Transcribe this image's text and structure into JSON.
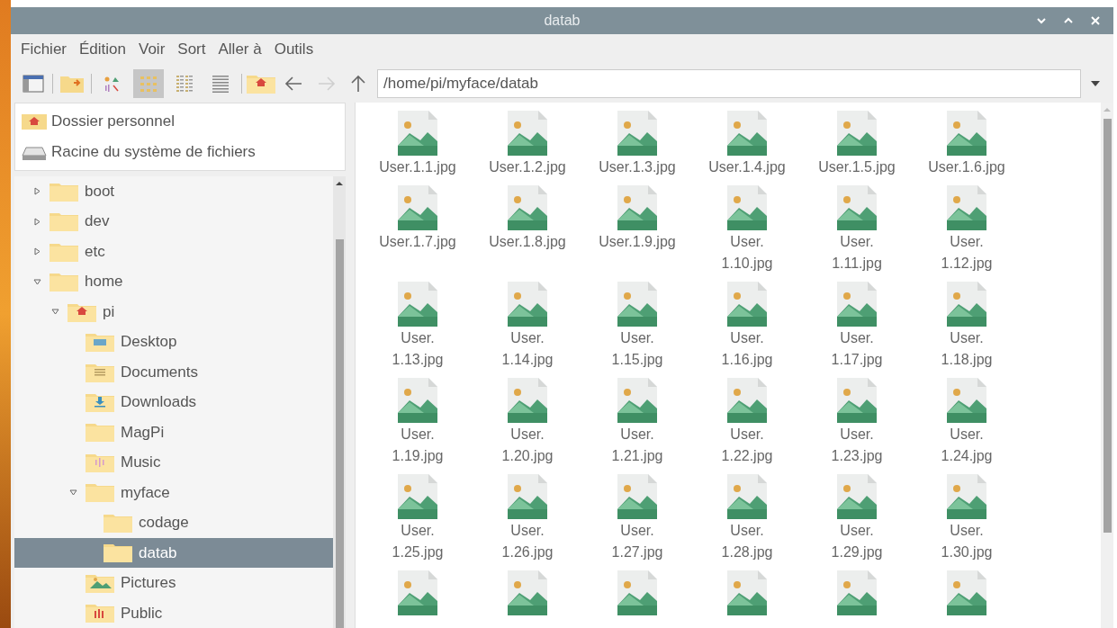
{
  "window": {
    "title": "datab",
    "controls": [
      {
        "kind": "minimize"
      },
      {
        "kind": "maximize"
      },
      {
        "kind": "close"
      }
    ]
  },
  "menu": [
    "Fichier",
    "Édition",
    "Voir",
    "Sort",
    "Aller à",
    "Outils"
  ],
  "toolbar": {
    "view_modes": [
      {
        "kind": "thumbnails",
        "selected": false
      },
      {
        "kind": "icons",
        "selected": true
      },
      {
        "kind": "compact",
        "selected": false
      },
      {
        "kind": "list",
        "selected": false
      }
    ],
    "nav": [
      {
        "kind": "back",
        "disabled": false
      },
      {
        "kind": "forward",
        "disabled": true
      },
      {
        "kind": "up",
        "disabled": false
      }
    ],
    "path": "/home/pi/myface/datab"
  },
  "places": [
    {
      "label": "Dossier personnel",
      "kind": "home"
    },
    {
      "label": "Racine du système de fichiers",
      "kind": "drive"
    }
  ],
  "tree": [
    {
      "label": "boot",
      "kind": "folder",
      "expanded": false,
      "selected": false
    },
    {
      "label": "dev",
      "kind": "folder",
      "expanded": false,
      "selected": false
    },
    {
      "label": "etc",
      "kind": "folder",
      "expanded": false,
      "selected": false
    },
    {
      "label": "home",
      "kind": "folder",
      "expanded": true,
      "selected": false,
      "children": [
        {
          "label": "pi",
          "kind": "home",
          "expanded": true,
          "selected": false,
          "children": [
            {
              "label": "Desktop",
              "kind": "desktop",
              "selected": false
            },
            {
              "label": "Documents",
              "kind": "documents",
              "selected": false
            },
            {
              "label": "Downloads",
              "kind": "downloads",
              "selected": false
            },
            {
              "label": "MagPi",
              "kind": "folder",
              "selected": false
            },
            {
              "label": "Music",
              "kind": "music",
              "selected": false
            },
            {
              "label": "myface",
              "kind": "folder",
              "expanded": true,
              "selected": false,
              "children": [
                {
                  "label": "codage",
                  "kind": "folder",
                  "selected": false
                },
                {
                  "label": "datab",
                  "kind": "folder",
                  "selected": true
                }
              ]
            },
            {
              "label": "Pictures",
              "kind": "pictures",
              "selected": false
            },
            {
              "label": "Public",
              "kind": "public",
              "selected": false
            }
          ]
        }
      ]
    }
  ],
  "files": [
    {
      "kind": "image",
      "lines": [
        "User.1.1.jpg"
      ]
    },
    {
      "kind": "image",
      "lines": [
        "User.1.2.jpg"
      ]
    },
    {
      "kind": "image",
      "lines": [
        "User.1.3.jpg"
      ]
    },
    {
      "kind": "image",
      "lines": [
        "User.1.4.jpg"
      ]
    },
    {
      "kind": "image",
      "lines": [
        "User.1.5.jpg"
      ]
    },
    {
      "kind": "image",
      "lines": [
        "User.1.6.jpg"
      ]
    },
    {
      "kind": "image",
      "lines": [
        "User.1.7.jpg"
      ]
    },
    {
      "kind": "image",
      "lines": [
        "User.1.8.jpg"
      ]
    },
    {
      "kind": "image",
      "lines": [
        "User.1.9.jpg"
      ]
    },
    {
      "kind": "image",
      "lines": [
        "User.",
        "1.10.jpg"
      ]
    },
    {
      "kind": "image",
      "lines": [
        "User.",
        "1.11.jpg"
      ]
    },
    {
      "kind": "image",
      "lines": [
        "User.",
        "1.12.jpg"
      ]
    },
    {
      "kind": "image",
      "lines": [
        "User.",
        "1.13.jpg"
      ]
    },
    {
      "kind": "image",
      "lines": [
        "User.",
        "1.14.jpg"
      ]
    },
    {
      "kind": "image",
      "lines": [
        "User.",
        "1.15.jpg"
      ]
    },
    {
      "kind": "image",
      "lines": [
        "User.",
        "1.16.jpg"
      ]
    },
    {
      "kind": "image",
      "lines": [
        "User.",
        "1.17.jpg"
      ]
    },
    {
      "kind": "image",
      "lines": [
        "User.",
        "1.18.jpg"
      ]
    },
    {
      "kind": "image",
      "lines": [
        "User.",
        "1.19.jpg"
      ]
    },
    {
      "kind": "image",
      "lines": [
        "User.",
        "1.20.jpg"
      ]
    },
    {
      "kind": "image",
      "lines": [
        "User.",
        "1.21.jpg"
      ]
    },
    {
      "kind": "image",
      "lines": [
        "User.",
        "1.22.jpg"
      ]
    },
    {
      "kind": "image",
      "lines": [
        "User.",
        "1.23.jpg"
      ]
    },
    {
      "kind": "image",
      "lines": [
        "User.",
        "1.24.jpg"
      ]
    },
    {
      "kind": "image",
      "lines": [
        "User.",
        "1.25.jpg"
      ]
    },
    {
      "kind": "image",
      "lines": [
        "User.",
        "1.26.jpg"
      ]
    },
    {
      "kind": "image",
      "lines": [
        "User.",
        "1.27.jpg"
      ]
    },
    {
      "kind": "image",
      "lines": [
        "User.",
        "1.28.jpg"
      ]
    },
    {
      "kind": "image",
      "lines": [
        "User.",
        "1.29.jpg"
      ]
    },
    {
      "kind": "image",
      "lines": [
        "User.",
        "1.30.jpg"
      ]
    },
    {
      "kind": "image"
    },
    {
      "kind": "image"
    },
    {
      "kind": "image"
    },
    {
      "kind": "image"
    },
    {
      "kind": "image"
    },
    {
      "kind": "image"
    }
  ]
}
